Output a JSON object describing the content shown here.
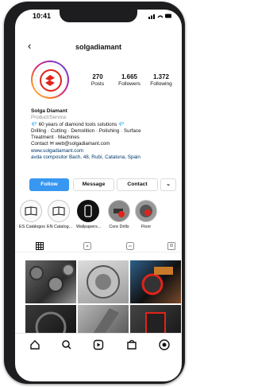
{
  "status_bar": {
    "time": "10:41",
    "icons": "••ll ☰ ▭"
  },
  "header": {
    "username": "solgadiamant"
  },
  "profile": {
    "stats": [
      {
        "value": "270",
        "label": "Posts"
      },
      {
        "value": "1.665",
        "label": "Followers"
      },
      {
        "value": "1.372",
        "label": "Following"
      }
    ],
    "bio": {
      "name": "Solga Diamant",
      "category": "Product/Service",
      "line1": "💎 60 years of diamond tools solutions 💎",
      "line2": "Drilling · Cutting · Demolition · Polishing · Surface",
      "line3": "Treatment · Machines",
      "contact": "Contact ✉ web@solgadiamant.com",
      "website": "www.solgadiamant.com",
      "address": "avda compositor Bach, 48, Rubí, Cataluna, Spain"
    }
  },
  "actions": {
    "follow": "Follow",
    "message": "Message",
    "contact": "Contact",
    "more": "⌄"
  },
  "highlights": [
    {
      "label": "ES Catálogos"
    },
    {
      "label": "EN Catalog..."
    },
    {
      "label": "Wallpapers..."
    },
    {
      "label": "Core Drills"
    },
    {
      "label": "Floor"
    }
  ],
  "colors": {
    "follow_button": "#3897f0",
    "link": "#00376b",
    "brand_red": "#e2231a"
  }
}
